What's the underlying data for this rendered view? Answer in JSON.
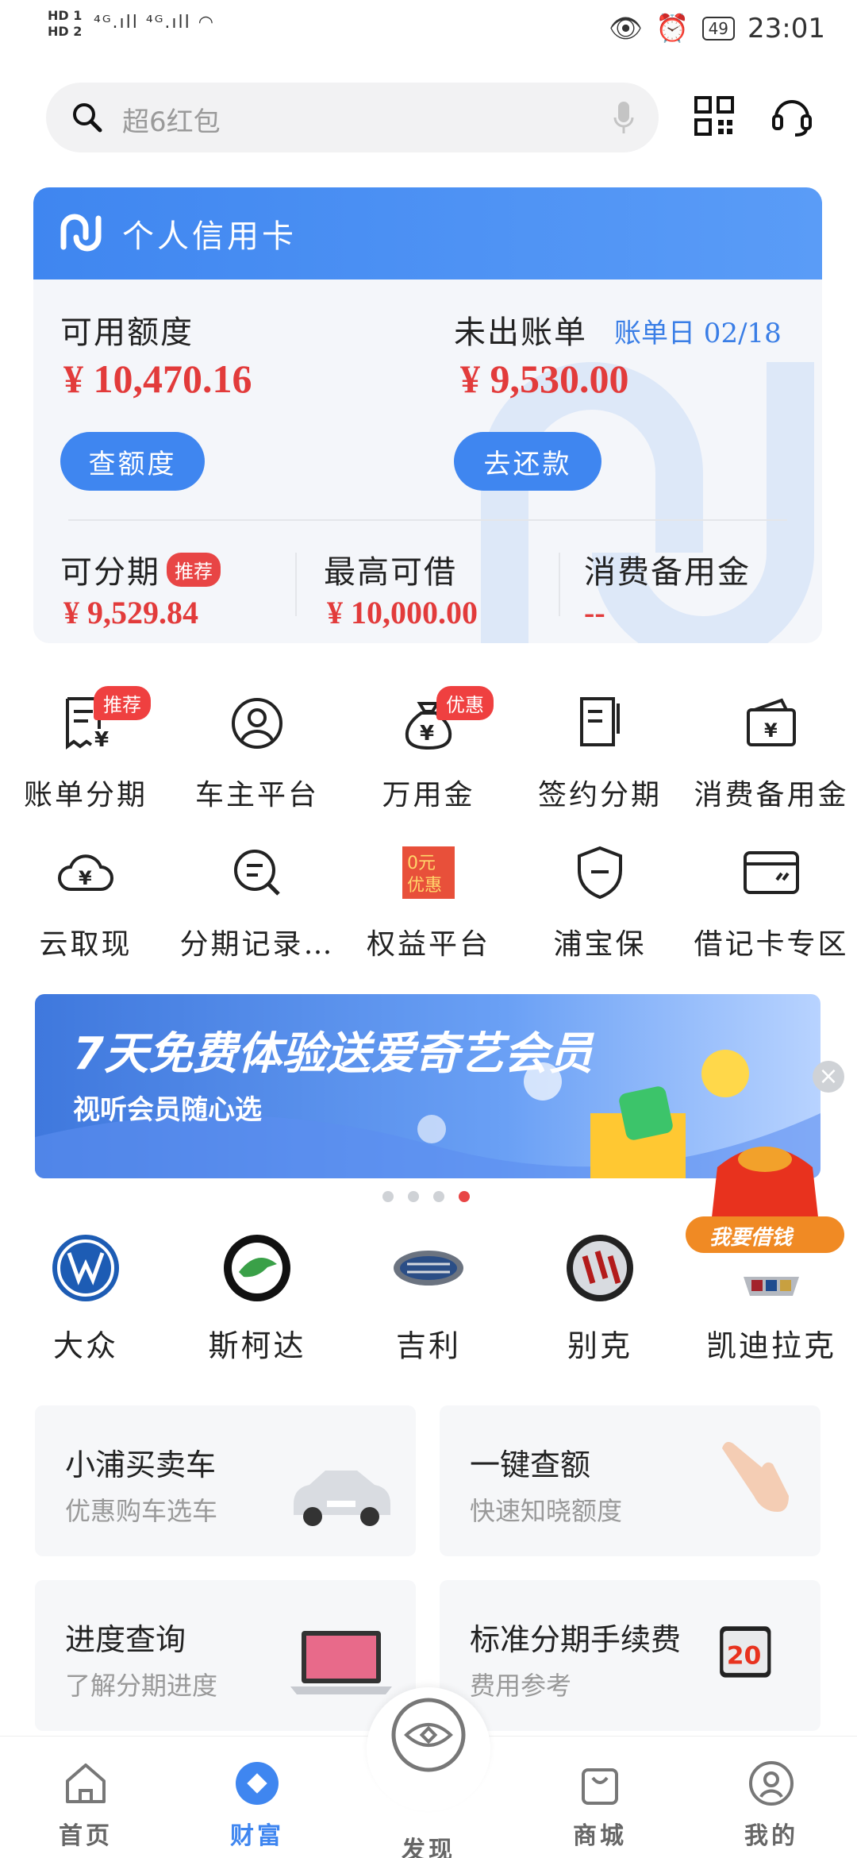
{
  "status": {
    "hd1": "HD 1",
    "hd2": "HD 2",
    "signal": "⁴ᴳ.ıll ⁴ᴳ.ıll",
    "battery": "49",
    "time": "23:01"
  },
  "search": {
    "placeholder": "超6红包"
  },
  "card": {
    "title": "个人信用卡",
    "available_label": "可用额度",
    "available_amount": "¥ 10,470.16",
    "check_button": "查额度",
    "unbilled_label": "未出账单",
    "bill_date": "账单日 02/18",
    "unbilled_amount": "¥ 9,530.00",
    "repay_button": "去还款",
    "installment_label": "可分期",
    "installment_tag": "推荐",
    "installment_amount": "¥ 9,529.84",
    "max_borrow_label": "最高可借",
    "max_borrow_amount": "¥ 10,000.00",
    "reserve_label": "消费备用金",
    "reserve_amount": "--"
  },
  "grid": {
    "row1": [
      {
        "label": "账单分期",
        "badge": "推荐"
      },
      {
        "label": "车主平台",
        "badge": ""
      },
      {
        "label": "万用金",
        "badge": "优惠"
      },
      {
        "label": "签约分期",
        "badge": ""
      },
      {
        "label": "消费备用金",
        "badge": ""
      }
    ],
    "row2": [
      {
        "label": "云取现"
      },
      {
        "label": "分期记录…"
      },
      {
        "label": "权益平台",
        "icon_text_1": "0元",
        "icon_text_2": "优惠"
      },
      {
        "label": "浦宝保"
      },
      {
        "label": "借记卡专区"
      }
    ]
  },
  "banner": {
    "headline": "7天免费体验送爱奇艺会员",
    "sub": "视听会员随心选",
    "redpacket_label": "我要借钱"
  },
  "brands": [
    "大众",
    "斯柯达",
    "吉利",
    "别克",
    "凯迪拉克"
  ],
  "features": [
    {
      "title": "小浦买卖车",
      "sub": "优惠购车选车"
    },
    {
      "title": "一键查额",
      "sub": "快速知晓额度"
    },
    {
      "title": "进度查询",
      "sub": "了解分期进度"
    },
    {
      "title": "标准分期手续费",
      "sub": "费用参考",
      "calendar_number": "20"
    }
  ],
  "nav": [
    {
      "label": "首页"
    },
    {
      "label": "财富"
    },
    {
      "label": "发现"
    },
    {
      "label": "商城"
    },
    {
      "label": "我的"
    }
  ],
  "colors": {
    "brand_blue": "#3f86f0",
    "accent_red": "#e23b3b"
  }
}
